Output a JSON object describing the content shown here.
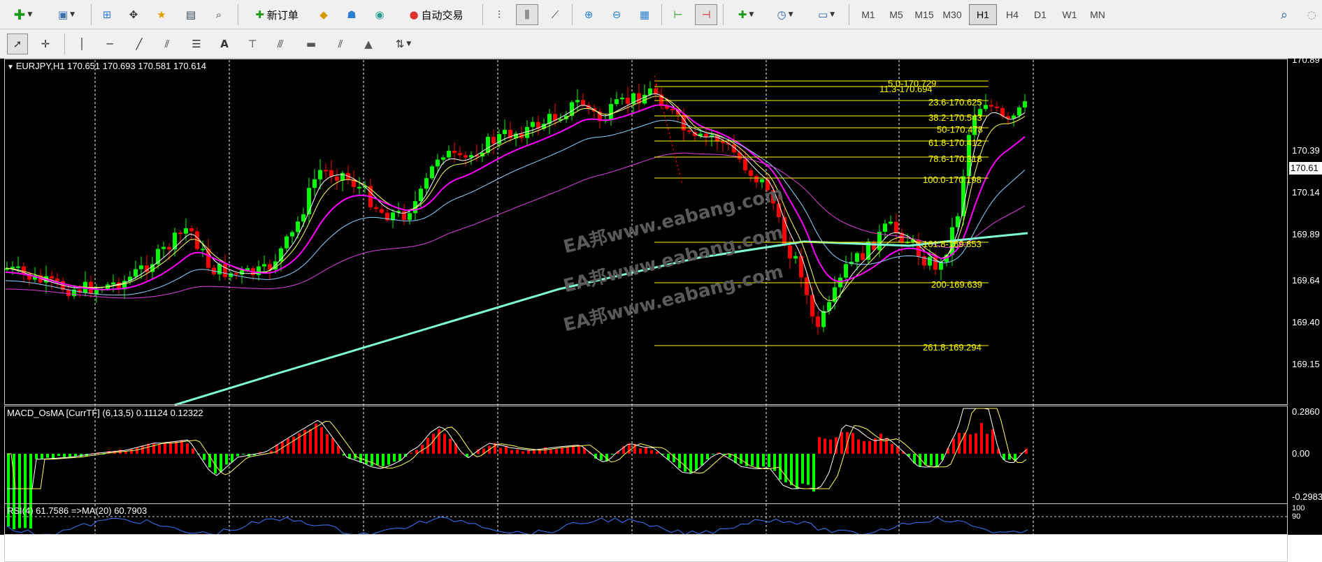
{
  "toolbar1": {
    "new_order_label": "新订单",
    "auto_trade_label": "自动交易",
    "timeframes": [
      "M1",
      "M5",
      "M15",
      "M30",
      "H1",
      "H4",
      "D1",
      "W1",
      "MN"
    ],
    "active_timeframe": "H1"
  },
  "chart": {
    "header": "EURJPY,H1  170.651 170.693 170.581 170.614",
    "current_price": "170.61",
    "price_axis": [
      "170.89",
      "170.61",
      "170.39",
      "170.14",
      "169.89",
      "169.64",
      "169.40",
      "169.15"
    ],
    "fib_levels": [
      "5.0-170.729",
      "11.3-170.694",
      "23.6-170.625",
      "38.2-170.543",
      "50-170.478",
      "61.8-170.412",
      "78.6-170.318",
      "100.0-170.198",
      "161.8-169.853",
      "200-169.639",
      "261.8-169.294"
    ],
    "watermark": "EA邦www.eabang.com"
  },
  "macd": {
    "header": "MACD_OsMA [CurrTF] (6,13,5) 0.11124 0.12322",
    "axis": [
      "0.2860",
      "0.00",
      "-0.2983"
    ]
  },
  "rsi": {
    "header": "RSI(4) 61.7586  =>MA(20) 60.7903",
    "axis": [
      "100",
      "90"
    ]
  },
  "colors": {
    "bull": "#00ff00",
    "bear": "#ff0000",
    "fib": "#ffff00",
    "ma_long": "#7fffd4",
    "ma_mid": "#ff00ff"
  }
}
